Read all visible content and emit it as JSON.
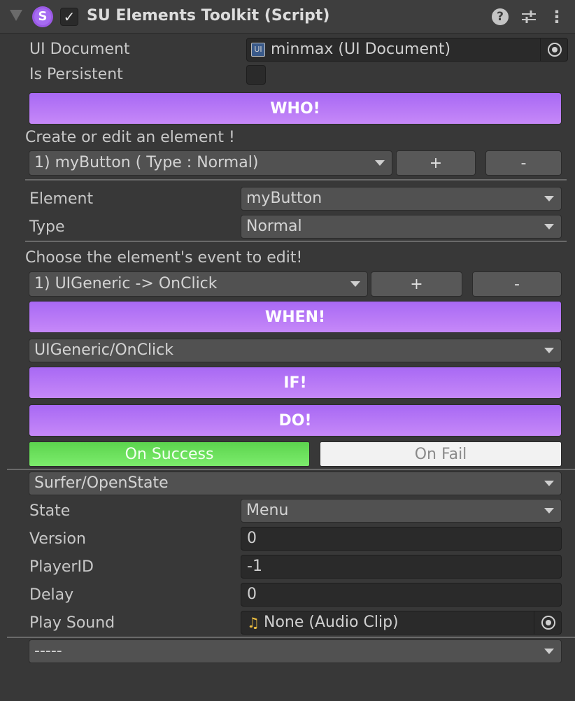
{
  "header": {
    "title": "SU Elements Toolkit (Script)",
    "logo_letter": "S",
    "enabled_check": "✓",
    "help_icon": "?",
    "presets_icon": "⊞",
    "more_icon": "⋮"
  },
  "fields": {
    "ui_document_label": "UI Document",
    "ui_document_value": "minmax (UI Document)",
    "ui_doc_icon_text": "UI",
    "is_persistent_label": "Is Persistent"
  },
  "buttons": {
    "who": "WHO!",
    "when": "WHEN!",
    "if": "IF!",
    "do": "DO!",
    "add": "+",
    "remove": "-"
  },
  "element_section": {
    "prompt": "Create or edit an element !",
    "selected": "1) myButton   ( Type : Normal)",
    "element_label": "Element",
    "element_value": "myButton",
    "type_label": "Type",
    "type_value": "Normal"
  },
  "event_section": {
    "prompt": "Choose the element's event to edit!",
    "selected": "1) UIGeneric -> OnClick",
    "trigger": "UIGeneric/OnClick"
  },
  "result_tabs": {
    "success": "On Success",
    "fail": "On Fail"
  },
  "action": {
    "selected": "Surfer/OpenState",
    "state_label": "State",
    "state_value": "Menu",
    "version_label": "Version",
    "version_value": "0",
    "player_label": "PlayerID",
    "player_value": "-1",
    "delay_label": "Delay",
    "delay_value": "0",
    "sound_label": "Play Sound",
    "sound_value": "None (Audio Clip)",
    "sound_icon": "♫"
  },
  "footer": {
    "empty_dropdown": "-----"
  },
  "colors": {
    "accent_purple": "#b47af6",
    "success_green": "#5ee05a",
    "fail_white": "#f2f2f2",
    "background": "#383838"
  }
}
